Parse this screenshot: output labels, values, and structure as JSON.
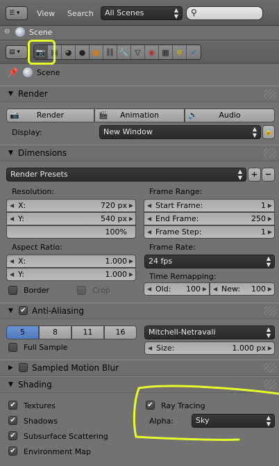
{
  "outliner": {
    "menu_view": "View",
    "menu_search": "Search",
    "scenes_dropdown": "All Scenes",
    "scene_item": "Scene"
  },
  "properties": {
    "context_label": "Scene",
    "tabs": [
      "render-icon",
      "render-layers-icon",
      "scene-icon",
      "world-icon",
      "object-icon",
      "constraints-icon",
      "modifiers-icon",
      "data-icon",
      "material-icon",
      "texture-icon",
      "particles-icon",
      "physics-icon"
    ]
  },
  "render_panel": {
    "title": "Render",
    "render_btn": "Render",
    "animation_btn": "Animation",
    "audio_btn": "Audio",
    "display_label": "Display:",
    "display_value": "New Window"
  },
  "dimensions_panel": {
    "title": "Dimensions",
    "presets": "Render Presets",
    "resolution_label": "Resolution:",
    "res_x_label": "X:",
    "res_x": "720 px",
    "res_y_label": "Y:",
    "res_y": "540 px",
    "res_pct": "100%",
    "frame_range_label": "Frame Range:",
    "start_label": "Start Frame:",
    "start": "1",
    "end_label": "End Frame:",
    "end": "250",
    "step_label": "Frame Step:",
    "step": "1",
    "aspect_label": "Aspect Ratio:",
    "asp_x_label": "X:",
    "asp_x": "1.000",
    "asp_y_label": "Y:",
    "asp_y": "1.000",
    "frame_rate_label": "Frame Rate:",
    "fps": "24 fps",
    "border_label": "Border",
    "crop_label": "Crop",
    "remap_label": "Time Remapping:",
    "old_label": "Old:",
    "old": "100",
    "new_label": "New:",
    "new": "100"
  },
  "aa_panel": {
    "title": "Anti-Aliasing",
    "samples": [
      "5",
      "8",
      "11",
      "16"
    ],
    "filter": "Mitchell-Netravali",
    "full_sample": "Full Sample",
    "size_label": "Size:",
    "size": "1.000 px"
  },
  "motion_blur_panel": {
    "title": "Sampled Motion Blur"
  },
  "shading_panel": {
    "title": "Shading",
    "textures": "Textures",
    "shadows": "Shadows",
    "sss": "Subsurface Scattering",
    "env_map": "Environment Map",
    "ray_tracing": "Ray Tracing",
    "alpha_label": "Alpha:",
    "alpha_value": "Sky"
  },
  "colors": {
    "highlight": "#e6ff2a",
    "selected_sample": "#5680c2"
  }
}
